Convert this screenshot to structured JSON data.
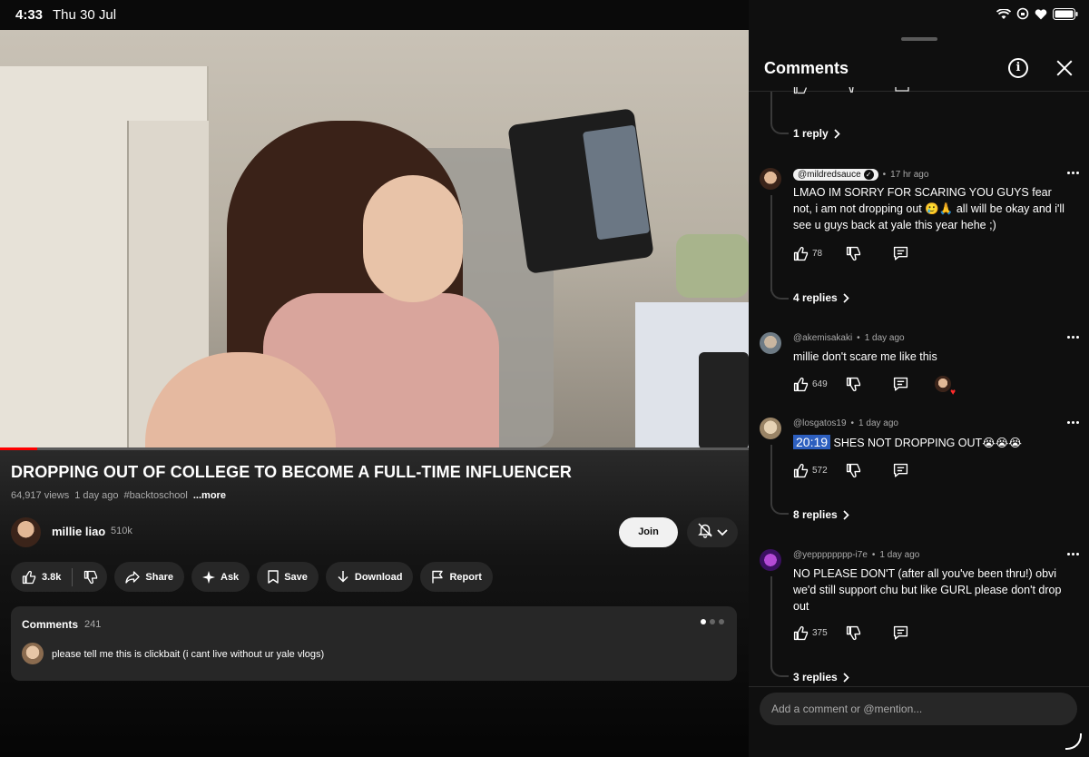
{
  "status_bar": {
    "time": "4:33",
    "date": "Thu 30 Jul"
  },
  "video": {
    "title": "DROPPING OUT OF COLLEGE TO BECOME A FULL-TIME INFLUENCER",
    "views": "64,917 views",
    "age": "1 day ago",
    "hashtag": "#backtoschool",
    "more": "...more",
    "progress_fraction": 0.05
  },
  "channel": {
    "name": "millie liao",
    "subscribers": "510k",
    "join_label": "Join"
  },
  "actions": {
    "like_count": "3.8k",
    "share": "Share",
    "ask": "Ask",
    "save": "Save",
    "download": "Download",
    "report": "Report"
  },
  "comments_card": {
    "header": "Comments",
    "count": "241",
    "top_comment": "please tell me this is clickbait (i cant live without ur yale vlogs)"
  },
  "panel": {
    "title": "Comments",
    "top_partial_replies": "1 reply",
    "input_placeholder": "Add a comment or @mention...",
    "comments": [
      {
        "author": "@mildredsauce",
        "verified": true,
        "time": "17 hr ago",
        "text": "LMAO IM SORRY FOR SCARING YOU GUYS fear not, i am not dropping out 🥲🙏 all will be okay and i'll see u guys back at yale this year hehe ;)",
        "likes": "78",
        "replies": "4 replies"
      },
      {
        "author": "@akemisakaki",
        "time": "1 day ago",
        "text": "millie don't scare me like this",
        "likes": "649",
        "creator_heart": true
      },
      {
        "author": "@losgatos19",
        "time": "1 day ago",
        "timestamp": "20:19",
        "text": " SHES NOT DROPPING OUT😭😭😭",
        "likes": "572",
        "replies": "8 replies"
      },
      {
        "author": "@yepppppppp-i7e",
        "time": "1 day ago",
        "text": "NO PLEASE DON'T (after all you've been thru!) obvi we'd still support chu but like GURL please don't drop out",
        "likes": "375",
        "replies": "3 replies"
      }
    ]
  },
  "colors": {
    "accent_red": "#ff0000",
    "timestamp_blue": "#2d5fbf",
    "heart": "#ff2b2b"
  }
}
